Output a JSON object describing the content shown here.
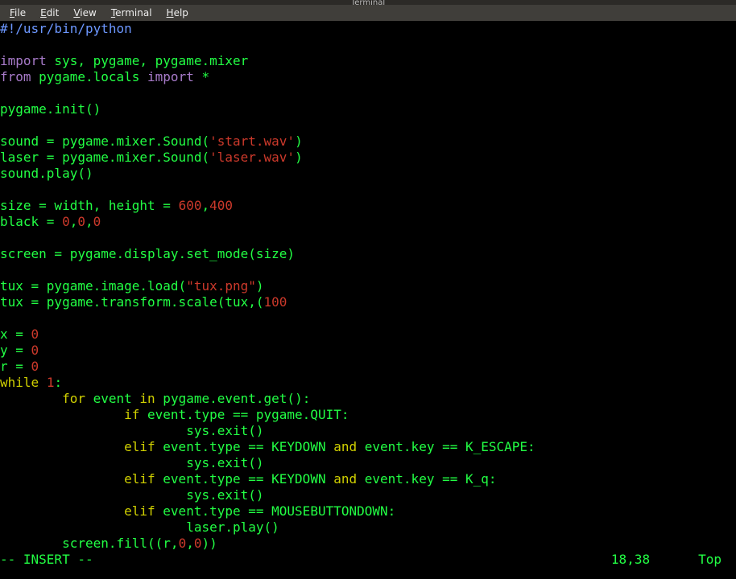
{
  "window": {
    "title": "Terminal"
  },
  "menubar": {
    "items": [
      {
        "label": "File",
        "accel": "F"
      },
      {
        "label": "Edit",
        "accel": "E"
      },
      {
        "label": "View",
        "accel": "V"
      },
      {
        "label": "Terminal",
        "accel": "T"
      },
      {
        "label": "Help",
        "accel": "H"
      }
    ]
  },
  "colors": {
    "keyword": "#d0d000",
    "string": "#cc392b",
    "comment": "#6c97ff",
    "default": "#22ff44",
    "import": "#a87bca"
  },
  "code": {
    "lines": [
      [
        {
          "t": "#!/usr/bin/python",
          "c": "c-blue"
        }
      ],
      [],
      [
        {
          "t": "import",
          "c": "c-purple"
        },
        {
          "t": " sys, pygame, pygame.mixer"
        }
      ],
      [
        {
          "t": "from",
          "c": "c-purple"
        },
        {
          "t": " pygame.locals "
        },
        {
          "t": "import",
          "c": "c-purple"
        },
        {
          "t": " *"
        }
      ],
      [],
      [
        {
          "t": "pygame.init()"
        }
      ],
      [],
      [
        {
          "t": "sound = pygame.mixer.Sound("
        },
        {
          "t": "'start.wav'",
          "c": "c-red"
        },
        {
          "t": ")"
        }
      ],
      [
        {
          "t": "laser = pygame.mixer.Sound("
        },
        {
          "t": "'laser.wav'",
          "c": "c-red"
        },
        {
          "t": ")"
        }
      ],
      [
        {
          "t": "sound.play()"
        }
      ],
      [],
      [
        {
          "t": "size = width, height = "
        },
        {
          "t": "600",
          "c": "c-red"
        },
        {
          "t": ","
        },
        {
          "t": "400",
          "c": "c-red"
        }
      ],
      [
        {
          "t": "black = "
        },
        {
          "t": "0",
          "c": "c-red"
        },
        {
          "t": ","
        },
        {
          "t": "0",
          "c": "c-red"
        },
        {
          "t": ","
        },
        {
          "t": "0",
          "c": "c-red"
        }
      ],
      [],
      [
        {
          "t": "screen = pygame.display.set_mode(size)"
        }
      ],
      [],
      [
        {
          "t": "tux = pygame.image.load("
        },
        {
          "t": "\"tux.png\"",
          "c": "c-red"
        },
        {
          "t": ")"
        }
      ],
      [
        {
          "t": "tux = pygame.transform.scale(tux,("
        },
        {
          "t": "100",
          "c": "c-red"
        }
      ],
      [],
      [
        {
          "t": "x = "
        },
        {
          "t": "0",
          "c": "c-red"
        }
      ],
      [
        {
          "t": "y = "
        },
        {
          "t": "0",
          "c": "c-red"
        }
      ],
      [
        {
          "t": "r = "
        },
        {
          "t": "0",
          "c": "c-red"
        }
      ],
      [
        {
          "t": "while",
          "c": "c-yellow"
        },
        {
          "t": " "
        },
        {
          "t": "1",
          "c": "c-red"
        },
        {
          "t": ":"
        }
      ],
      [
        {
          "t": "        "
        },
        {
          "t": "for",
          "c": "c-yellow"
        },
        {
          "t": " event "
        },
        {
          "t": "in",
          "c": "c-yellow"
        },
        {
          "t": " pygame.event.get():"
        }
      ],
      [
        {
          "t": "                "
        },
        {
          "t": "if",
          "c": "c-yellow"
        },
        {
          "t": " event.type == pygame.QUIT:"
        }
      ],
      [
        {
          "t": "                        sys.exit()"
        }
      ],
      [
        {
          "t": "                "
        },
        {
          "t": "elif",
          "c": "c-yellow"
        },
        {
          "t": " event.type == KEYDOWN "
        },
        {
          "t": "and",
          "c": "c-yellow"
        },
        {
          "t": " event.key == K_ESCAPE:"
        }
      ],
      [
        {
          "t": "                        sys.exit()"
        }
      ],
      [
        {
          "t": "                "
        },
        {
          "t": "elif",
          "c": "c-yellow"
        },
        {
          "t": " event.type == KEYDOWN "
        },
        {
          "t": "and",
          "c": "c-yellow"
        },
        {
          "t": " event.key == K_q:"
        }
      ],
      [
        {
          "t": "                        sys.exit()"
        }
      ],
      [
        {
          "t": "                "
        },
        {
          "t": "elif",
          "c": "c-yellow"
        },
        {
          "t": " event.type == MOUSEBUTTONDOWN:"
        }
      ],
      [
        {
          "t": "                        laser.play()"
        }
      ],
      [
        {
          "t": "        screen.fill((r,"
        },
        {
          "t": "0",
          "c": "c-red"
        },
        {
          "t": ","
        },
        {
          "t": "0",
          "c": "c-red"
        },
        {
          "t": "))"
        }
      ]
    ]
  },
  "status": {
    "mode": "-- INSERT --",
    "position": "18,38",
    "scroll": "Top"
  }
}
